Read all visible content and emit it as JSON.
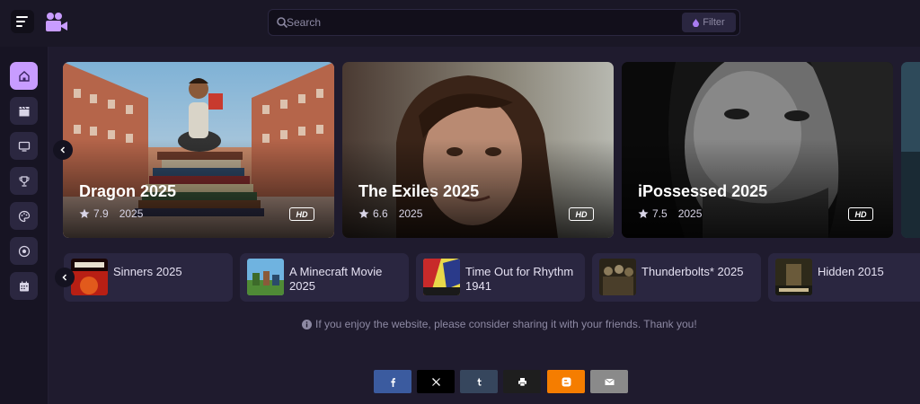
{
  "header": {
    "search_placeholder": "Search",
    "filter_label": "Filter"
  },
  "sidebar": {
    "items": [
      {
        "icon": "home-icon",
        "active": true
      },
      {
        "icon": "clapperboard-icon",
        "active": false
      },
      {
        "icon": "tv-icon",
        "active": false
      },
      {
        "icon": "trophy-icon",
        "active": false
      },
      {
        "icon": "palette-icon",
        "active": false
      },
      {
        "icon": "football-icon",
        "active": false
      },
      {
        "icon": "calendar-icon",
        "active": false
      }
    ]
  },
  "featured": [
    {
      "title": "Dragon 2025",
      "rating": "7.9",
      "year": "2025",
      "quality": "HD"
    },
    {
      "title": "The Exiles 2025",
      "rating": "6.6",
      "year": "2025",
      "quality": "HD"
    },
    {
      "title": "iPossessed 2025",
      "rating": "7.5",
      "year": "2025",
      "quality": "HD"
    }
  ],
  "trending": [
    {
      "title": "Sinners 2025"
    },
    {
      "title": "A Minecraft Movie 2025"
    },
    {
      "title": "Time Out for Rhythm 1941"
    },
    {
      "title": "Thunderbolts* 2025"
    },
    {
      "title": "Hidden 2015"
    }
  ],
  "info_text": "If you enjoy the website, please consider sharing it with your friends. Thank you!",
  "share": [
    {
      "name": "facebook",
      "color": "#3b5b9f"
    },
    {
      "name": "x",
      "color": "#000000"
    },
    {
      "name": "tumblr",
      "color": "#36465d"
    },
    {
      "name": "print",
      "color": "#1e1e1e"
    },
    {
      "name": "blogger",
      "color": "#f57d00"
    },
    {
      "name": "email",
      "color": "#8a8a8a"
    }
  ],
  "colors": {
    "accent": "#c89cff",
    "background": "#1f1b2e",
    "card": "#2a2640"
  }
}
